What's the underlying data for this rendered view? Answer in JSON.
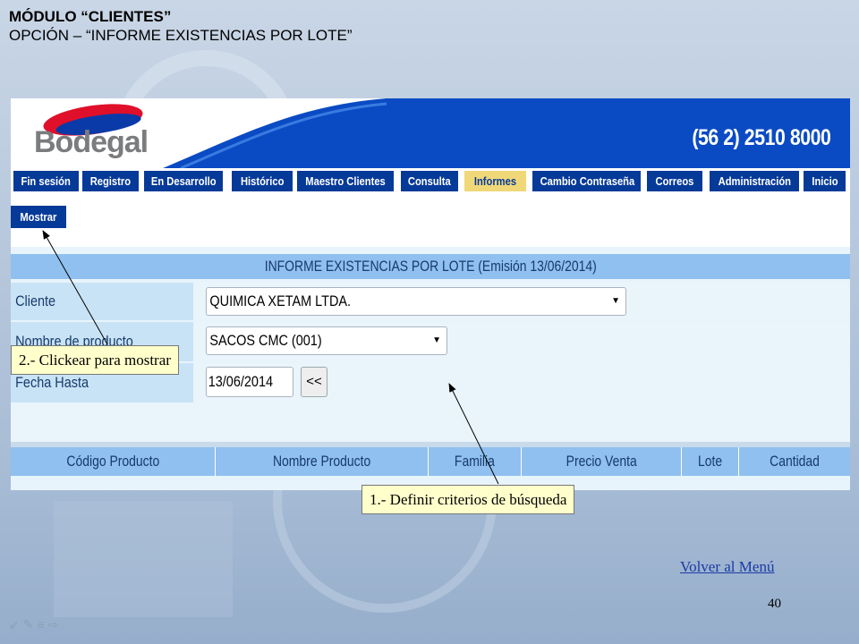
{
  "slide": {
    "title_line1": "MÓDULO “CLIENTES”",
    "title_line2": "OPCIÓN – “INFORME EXISTENCIAS POR LOTE”",
    "back_link": "Volver al Menú",
    "page_number": "40"
  },
  "app": {
    "logo_text": "Bodegal",
    "phone": "(56 2) 2510 8000",
    "nav": [
      {
        "label": "Fin sesión"
      },
      {
        "label": "Registro"
      },
      {
        "label": "En Desarrollo"
      },
      {
        "label": "Histórico"
      },
      {
        "label": "Maestro Clientes"
      },
      {
        "label": "Consulta"
      },
      {
        "label": "Informes",
        "active": true
      },
      {
        "label": "Cambio Contraseña"
      },
      {
        "label": "Correos"
      },
      {
        "label": "Administración"
      },
      {
        "label": "Inicio"
      }
    ],
    "mostrar_label": "Mostrar",
    "report_title": "INFORME EXISTENCIAS POR LOTE (Emisión 13/06/2014)",
    "form": {
      "cliente_label": "Cliente",
      "cliente_value": "QUIMICA XETAM LTDA.",
      "producto_label": "Nombre de producto",
      "producto_value": "SACOS CMC (001)",
      "fecha_label": "Fecha Hasta",
      "fecha_value": "13/06/2014",
      "fecha_button": "<<"
    },
    "table_headers": [
      "Código Producto",
      "Nombre Producto",
      "Familia",
      "Precio Venta",
      "Lote",
      "Cantidad"
    ]
  },
  "callouts": {
    "mostrar": "2.- Clickear para mostrar",
    "criterios": "1.- Definir criterios de búsqueda"
  },
  "colors": {
    "nav_bg": "#063a99",
    "nav_active": "#f0d878",
    "header_blue": "#8fc0ef",
    "callout_bg": "#ffffcc"
  }
}
